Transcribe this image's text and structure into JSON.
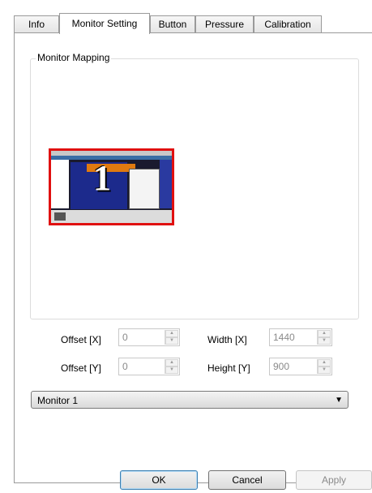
{
  "tabs": [
    {
      "label": "Info"
    },
    {
      "label": "Monitor Setting"
    },
    {
      "label": "Button"
    },
    {
      "label": "Pressure"
    },
    {
      "label": "Calibration"
    }
  ],
  "active_tab": "Monitor Setting",
  "monitor_mapping": {
    "group_label": "Monitor Mapping",
    "monitor_number": "1"
  },
  "fields": {
    "offset_x": {
      "label": "Offset [X]",
      "value": "0"
    },
    "offset_y": {
      "label": "Offset [Y]",
      "value": "0"
    },
    "width_x": {
      "label": "Width [X]",
      "value": "1440"
    },
    "height_y": {
      "label": "Height [Y]",
      "value": "900"
    }
  },
  "monitor_select": {
    "selected": "Monitor 1"
  },
  "buttons": {
    "ok": "OK",
    "cancel": "Cancel",
    "apply": "Apply"
  },
  "colors": {
    "selection_border": "#e01010",
    "default_button_border": "#3c7fb1"
  }
}
